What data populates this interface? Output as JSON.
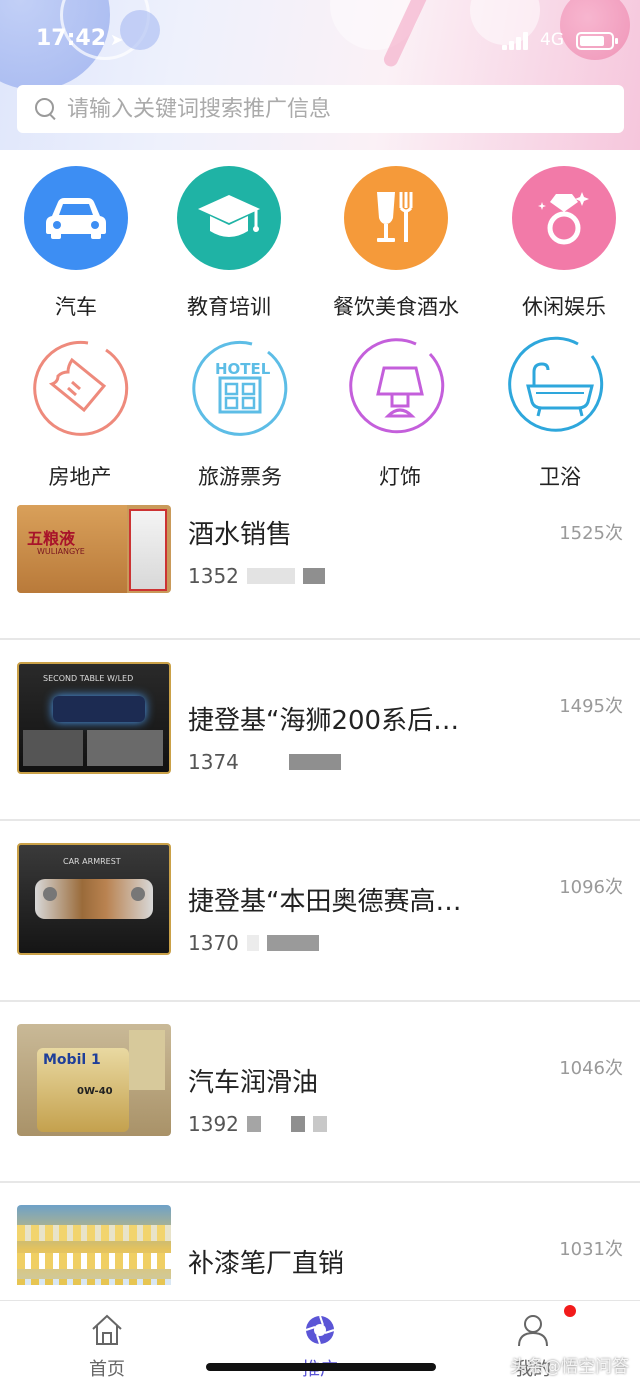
{
  "status_bar": {
    "time": "17:42",
    "network": "4G"
  },
  "search": {
    "placeholder": "请输入关键词搜索推广信息"
  },
  "categories": [
    {
      "label": "汽车",
      "icon": "car-icon",
      "color": "#3d8ef3"
    },
    {
      "label": "教育培训",
      "icon": "graduation-cap-icon",
      "color": "#1fb3a5"
    },
    {
      "label": "餐饮美食酒水",
      "icon": "food-drink-icon",
      "color": "#f59a3a"
    },
    {
      "label": "休闲娱乐",
      "icon": "diamond-ring-icon",
      "color": "#f27aa8"
    },
    {
      "label": "房地产",
      "icon": "ticket-icon",
      "color": "#ee8a7c"
    },
    {
      "label": "旅游票务",
      "icon": "hotel-icon",
      "color": "#5dbde6"
    },
    {
      "label": "灯饰",
      "icon": "lamp-icon",
      "color": "#c45fdb"
    },
    {
      "label": "卫浴",
      "icon": "bathtub-icon",
      "color": "#2ea7dc"
    }
  ],
  "listings": [
    {
      "title": "酒水销售",
      "phone_prefix": "1352",
      "views": "1525次",
      "thumb": "liquor-box-image",
      "thumb_text": "五粮液",
      "thumb_subtext": "WULIANGYE"
    },
    {
      "title": "捷登基“海狮200系后…",
      "phone_prefix": "1374",
      "views": "1495次",
      "thumb": "car-table-image",
      "thumb_text": "SECOND TABLE W/LED"
    },
    {
      "title": "捷登基“本田奥德赛高…",
      "phone_prefix": "1370",
      "views": "1096次",
      "thumb": "car-armrest-image",
      "thumb_text": "CAR ARMREST"
    },
    {
      "title": "汽车润滑油",
      "phone_prefix": "1392",
      "views": "1046次",
      "thumb": "motor-oil-image",
      "thumb_text": "Mobil 1",
      "thumb_subtext": "0W-40"
    },
    {
      "title": "补漆笔厂直销",
      "phone_prefix": "",
      "views": "1031次",
      "thumb": "paint-pen-image"
    }
  ],
  "tabbar": {
    "items": [
      {
        "label": "首页",
        "icon": "home-icon"
      },
      {
        "label": "推广",
        "icon": "aperture-icon"
      },
      {
        "label": "我的",
        "icon": "user-icon"
      }
    ],
    "active_color": "#5b55d6",
    "badge_color": "#f21b1b"
  },
  "watermark": "头条@悟空问答"
}
